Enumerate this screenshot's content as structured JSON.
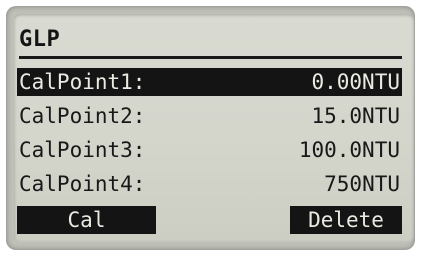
{
  "screen": {
    "title": "GLP"
  },
  "calpoints": [
    {
      "label": "CalPoint1:",
      "value": "0.00NTU",
      "selected": true
    },
    {
      "label": "CalPoint2:",
      "value": "15.0NTU",
      "selected": false
    },
    {
      "label": "CalPoint3:",
      "value": "100.0NTU",
      "selected": false
    },
    {
      "label": "CalPoint4:",
      "value": "750NTU",
      "selected": false
    }
  ],
  "softkeys": {
    "left_label": "Cal",
    "right_label": "Delete"
  },
  "colors": {
    "lcd_background": "#d6d8ce",
    "lcd_ink": "#141414",
    "bezel": "#bfc0b8"
  }
}
